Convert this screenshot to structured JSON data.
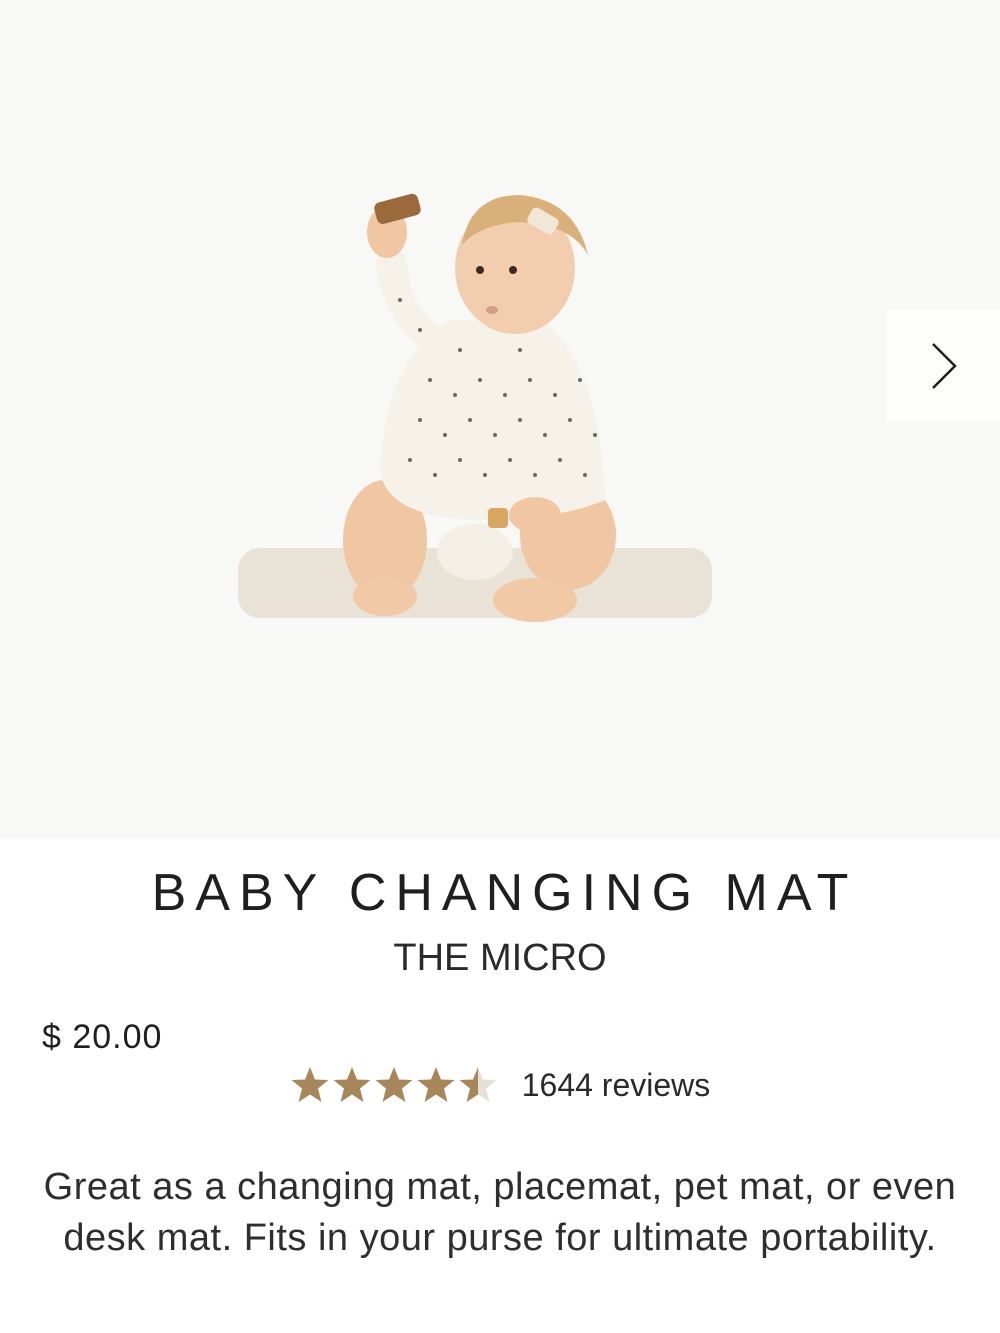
{
  "product": {
    "title": "BABY CHANGING MAT",
    "subtitle": "THE MICRO",
    "price": "$ 20.00",
    "rating": 4.5,
    "rating_max": 5,
    "reviews_label": "1644 reviews",
    "description": "Great as a changing mat, placemat, pet mat, or even desk mat. Fits in your purse for ultimate portability."
  },
  "gallery": {
    "next_icon": "chevron-right-icon"
  },
  "colors": {
    "star": "#a7865a",
    "star_empty": "#e6e0d6",
    "hero_background": "#f8f8f6",
    "text": "#1f1f1f"
  }
}
